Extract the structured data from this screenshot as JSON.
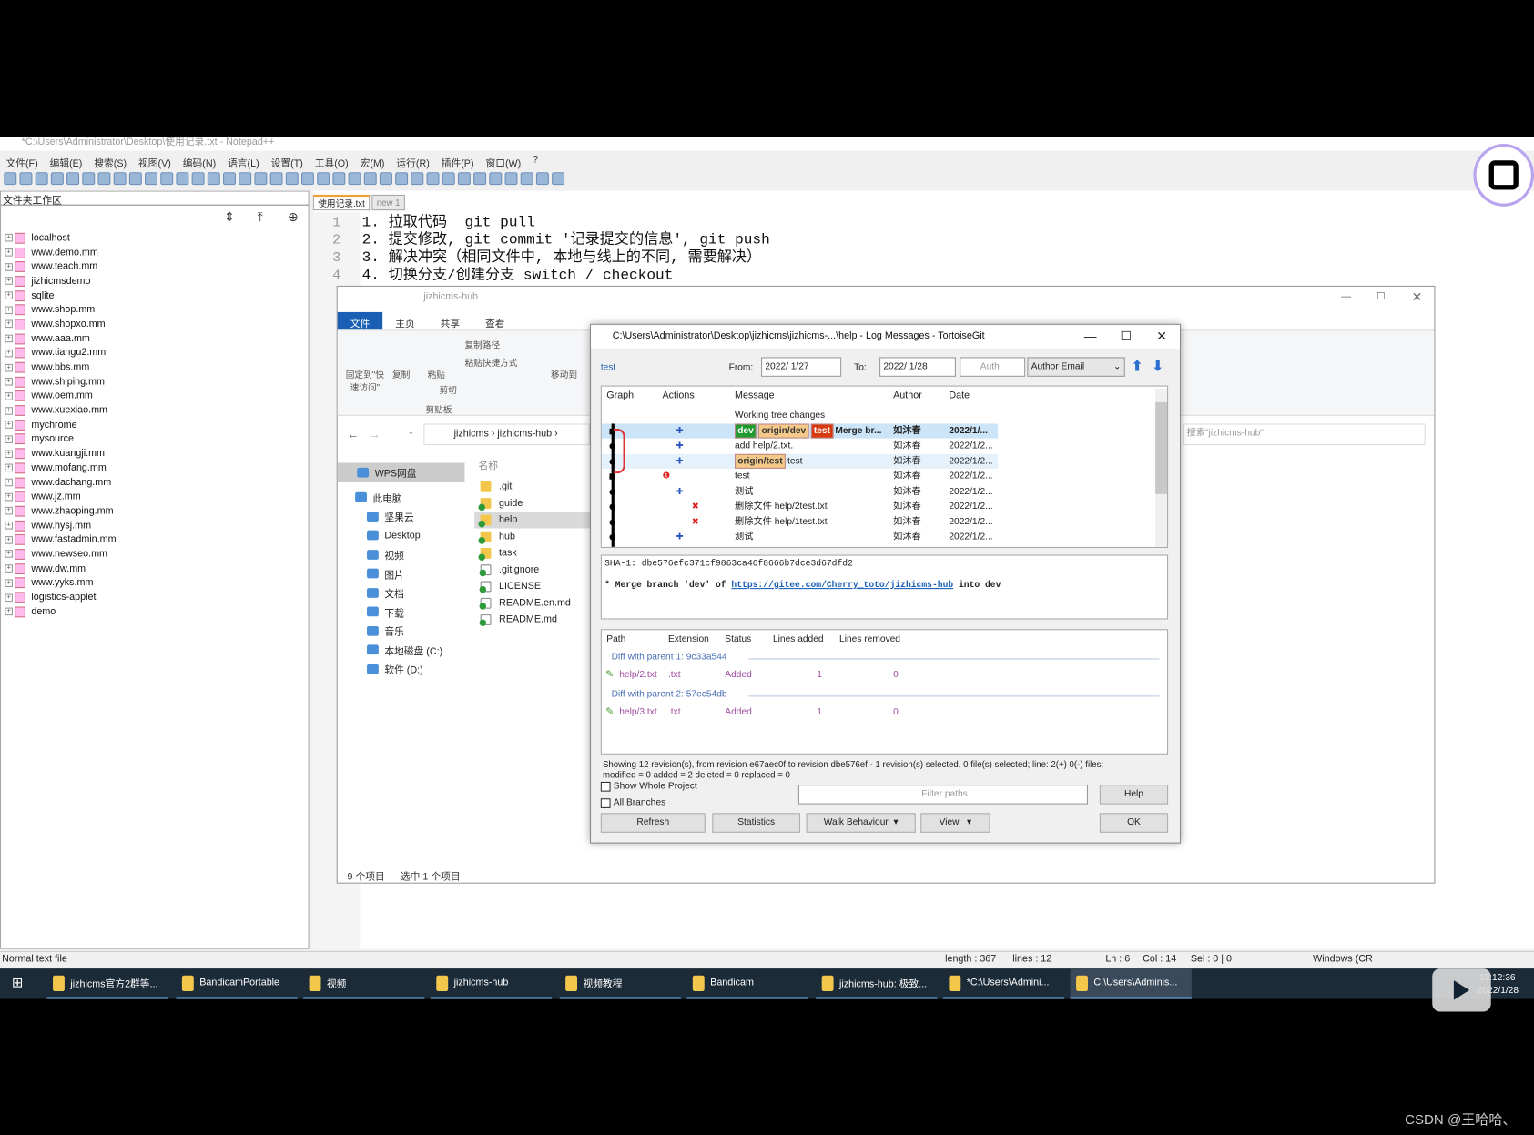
{
  "notepad": {
    "title": "*C:\\Users\\Administrator\\Desktop\\使用记录.txt - Notepad++",
    "menu": [
      "文件(F)",
      "编辑(E)",
      "搜索(S)",
      "视图(V)",
      "编码(N)",
      "语言(L)",
      "设置(T)",
      "工具(O)",
      "宏(M)",
      "运行(R)",
      "插件(P)",
      "窗口(W)",
      "?"
    ],
    "panel_title": "文件夹工作区",
    "folders": [
      "localhost",
      "www.demo.mm",
      "www.teach.mm",
      "jizhicmsdemo",
      "sqlite",
      "www.shop.mm",
      "www.shopxo.mm",
      "www.aaa.mm",
      "www.tiangu2.mm",
      "www.bbs.mm",
      "www.shiping.mm",
      "www.oem.mm",
      "www.xuexiao.mm",
      "mychrome",
      "mysource",
      "www.kuangji.mm",
      "www.mofang.mm",
      "www.dachang.mm",
      "www.jz.mm",
      "www.zhaoping.mm",
      "www.hysj.mm",
      "www.fastadmin.mm",
      "www.newseo.mm",
      "www.dw.mm",
      "www.yyks.mm",
      "logistics-applet",
      "demo"
    ],
    "tabs": [
      "使用记录.txt",
      "new 1"
    ],
    "line_numbers": [
      "1",
      "2",
      "3",
      "4"
    ],
    "lines": [
      "1. 拉取代码  git pull",
      "2. 提交修改, git commit '记录提交的信息', git push",
      "3. 解决冲突（相同文件中, 本地与线上的不同, 需要解决）",
      "4. 切换分支/创建分支 switch / checkout"
    ],
    "status": {
      "type": "Normal text file",
      "length": "length : 367",
      "lines": "lines : 12",
      "ln": "Ln : 6",
      "col": "Col : 14",
      "sel": "Sel : 0 | 0",
      "eol": "Windows (CR"
    }
  },
  "explorer": {
    "title": "jizhicms-hub",
    "ribbon_tabs": [
      "文件",
      "主页",
      "共享",
      "查看"
    ],
    "ribbon": {
      "pin": "固定到\"快速访问\"",
      "copy": "复制",
      "paste": "粘贴",
      "copy_path": "复制路径",
      "paste_shortcut": "粘贴快捷方式",
      "cut": "剪切",
      "clipboard": "剪贴板",
      "move_to": "移动到"
    },
    "breadcrumb": [
      "jizhicms",
      "jizhicms-hub"
    ],
    "search_placeholder": "搜索\"jizhicms-hub\"",
    "column_name": "名称",
    "nav": [
      "WPS网盘",
      "此电脑",
      "坚果云",
      "Desktop",
      "视频",
      "图片",
      "文档",
      "下载",
      "音乐",
      "本地磁盘 (C:)",
      "软件 (D:)"
    ],
    "files": [
      ".git",
      "guide",
      "help",
      "hub",
      "task",
      ".gitignore",
      "LICENSE",
      "README.en.md",
      "README.md"
    ],
    "status": {
      "count": "9 个项目",
      "selected": "选中 1 个项目"
    }
  },
  "tortoise": {
    "title": "C:\\Users\\Administrator\\Desktop\\jizhicms\\jizhicms-...\\help - Log Messages - TortoiseGit",
    "branch_link": "test",
    "from_label": "From:",
    "from": "2022/ 1/27",
    "to_label": "To:",
    "to": "2022/ 1/28",
    "search_placeholder": "Auth",
    "filter_by": "Author Email",
    "columns": [
      "Graph",
      "Actions",
      "Message",
      "Author",
      "Date"
    ],
    "rows": [
      {
        "message": "Working tree changes",
        "author": "",
        "date": "",
        "refs": []
      },
      {
        "message": "Merge br...",
        "author": "如沐春",
        "date": "2022/1/...",
        "refs": [
          {
            "name": "dev",
            "color": "#1f9a2e"
          },
          {
            "name": "origin/dev",
            "color": "#f4c98a"
          },
          {
            "name": "test",
            "color": "#d83a10"
          }
        ],
        "bold": true,
        "action": "add"
      },
      {
        "message": "add help/2.txt.",
        "author": "如沐春",
        "date": "2022/1/2...",
        "refs": [],
        "action": "add"
      },
      {
        "message": "test",
        "author": "如沐春",
        "date": "2022/1/2...",
        "refs": [
          {
            "name": "origin/test",
            "color": "#f4c98a"
          }
        ],
        "action": "add"
      },
      {
        "message": "test",
        "author": "如沐春",
        "date": "2022/1/2...",
        "refs": [],
        "action": "conflict"
      },
      {
        "message": "测试",
        "author": "如沐春",
        "date": "2022/1/2...",
        "refs": [],
        "action": "add"
      },
      {
        "message": "删除文件 help/2test.txt",
        "author": "如沐春",
        "date": "2022/1/2...",
        "refs": [],
        "action": "delete"
      },
      {
        "message": "删除文件 help/1test.txt",
        "author": "如沐春",
        "date": "2022/1/2...",
        "refs": [],
        "action": "delete"
      },
      {
        "message": "测试",
        "author": "如沐春",
        "date": "2022/1/2...",
        "refs": [],
        "action": "add"
      }
    ],
    "sha": "SHA-1: dbe576efc371cf9863ca46f8666b7dce3d67dfd2",
    "commit_msg_pre": "* Merge branch 'dev' of ",
    "commit_link": "https://gitee.com/Cherry_toto/jizhicms-hub",
    "commit_msg_post": " into dev",
    "file_columns": [
      "Path",
      "Extension",
      "Status",
      "Lines added",
      "Lines removed"
    ],
    "groups": [
      {
        "label": "Diff with parent 1: 9c33a544",
        "files": [
          {
            "path": "help/2.txt",
            "ext": ".txt",
            "status": "Added",
            "added": "1",
            "removed": "0"
          }
        ]
      },
      {
        "label": "Diff with parent 2: 57ec54db",
        "files": [
          {
            "path": "help/3.txt",
            "ext": ".txt",
            "status": "Added",
            "added": "1",
            "removed": "0"
          }
        ]
      }
    ],
    "summary": "Showing 12 revision(s), from revision e67aec0f to revision dbe576ef - 1 revision(s) selected, 0 file(s) selected; line: 2(+) 0(-) files:",
    "summary2": "modified = 0 added = 2 deleted = 0 replaced = 0",
    "show_whole_project": "Show Whole Project",
    "all_branches": "All Branches",
    "filter_paths": "Filter paths",
    "buttons": {
      "help": "Help",
      "refresh": "Refresh",
      "statistics": "Statistics",
      "walk": "Walk Behaviour",
      "view": "View",
      "ok": "OK"
    }
  },
  "taskbar": {
    "items": [
      "jizhicms官方2群等...",
      "BandicamPortable",
      "视频",
      "jizhicms-hub",
      "视频教程",
      "Bandicam",
      "jizhicms-hub: 极致...",
      "*C:\\Users\\Admini...",
      "C:\\Users\\Adminis..."
    ],
    "time": "13:12:36",
    "date": "2022/1/28"
  },
  "watermark": "CSDN @王哈哈、",
  "colors": {
    "taskbar": "#1c2b38",
    "accent": "#1a5fb4",
    "selection": "#cce4f7"
  }
}
